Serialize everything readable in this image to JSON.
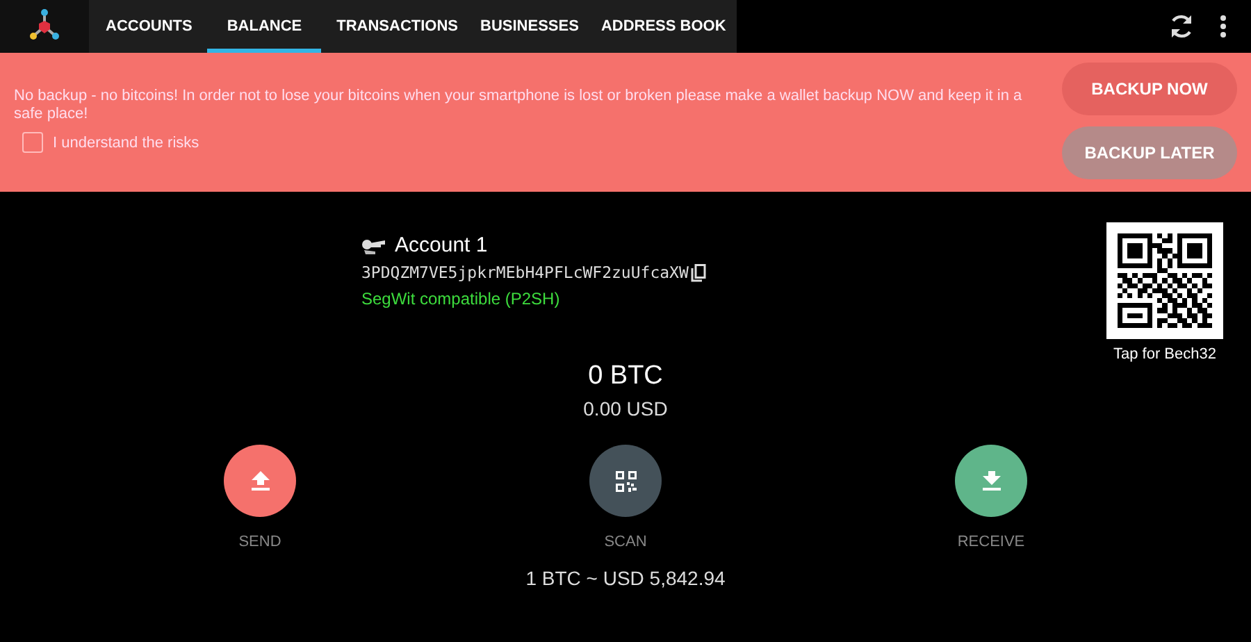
{
  "tabs": [
    {
      "label": "ACCOUNTS",
      "selected": false
    },
    {
      "label": "BALANCE",
      "selected": true
    },
    {
      "label": "TRANSACTIONS",
      "selected": false
    },
    {
      "label": "BUSINESSES",
      "selected": false
    },
    {
      "label": "ADDRESS BOOK",
      "selected": false
    }
  ],
  "backup_banner": {
    "message": "No backup - no bitcoins! In order not to lose your bitcoins when your smartphone is lost or broken please make a wallet backup NOW and keep it in a safe place!",
    "checkbox": {
      "label": "I understand the risks",
      "checked": false
    },
    "buttons": [
      {
        "label": "BACKUP NOW",
        "kind": "primary"
      },
      {
        "label": "BACKUP LATER",
        "kind": "secondary"
      }
    ]
  },
  "account": {
    "name": "Account 1",
    "address": "3PDQZM7VE5jpkrMEbH4PFLcWF2zuUfcaXW",
    "address_type": "SegWit compatible (P2SH)",
    "qr_caption": "Tap for Bech32"
  },
  "balance": {
    "btc": "0 BTC",
    "fiat": "0.00 USD"
  },
  "actions": [
    {
      "label": "SEND",
      "kind": "send"
    },
    {
      "label": "SCAN",
      "kind": "scan"
    },
    {
      "label": "RECEIVE",
      "kind": "receive"
    }
  ],
  "exchange_rate": "1 BTC ~ USD 5,842.94"
}
